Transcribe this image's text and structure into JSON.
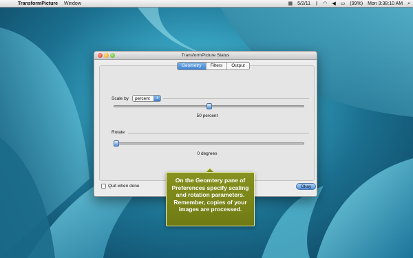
{
  "menubar": {
    "apple_icon": "apple-icon",
    "app_name": "TransformPicture",
    "menus": [
      "Window"
    ],
    "date": "5/2/11",
    "battery": "(99%)",
    "clock": "Mon 3:38:10 AM"
  },
  "window": {
    "title": "TransformPicture Status",
    "tabs": [
      "Geometry",
      "Filters",
      "Output"
    ],
    "active_tab": "Geometry",
    "scale": {
      "label": "Scale by",
      "unit_select": "percent",
      "value_text": "50 percent",
      "value_fraction": 0.5
    },
    "rotate": {
      "label": "Rotate",
      "value_text": "0 degrees",
      "value_fraction": 0.0
    },
    "quit_checkbox": {
      "label": "Quit when done",
      "checked": false
    },
    "okay_button": "Okay"
  },
  "callout": {
    "text": "On the Geomtery pane of Preferences specify scaling and rotation parameters.  Remember, copies of your images are processed."
  },
  "colors": {
    "accent": "#3f84d2",
    "callout_bg": "#7c8719",
    "desktop": "#2a8fb1"
  }
}
